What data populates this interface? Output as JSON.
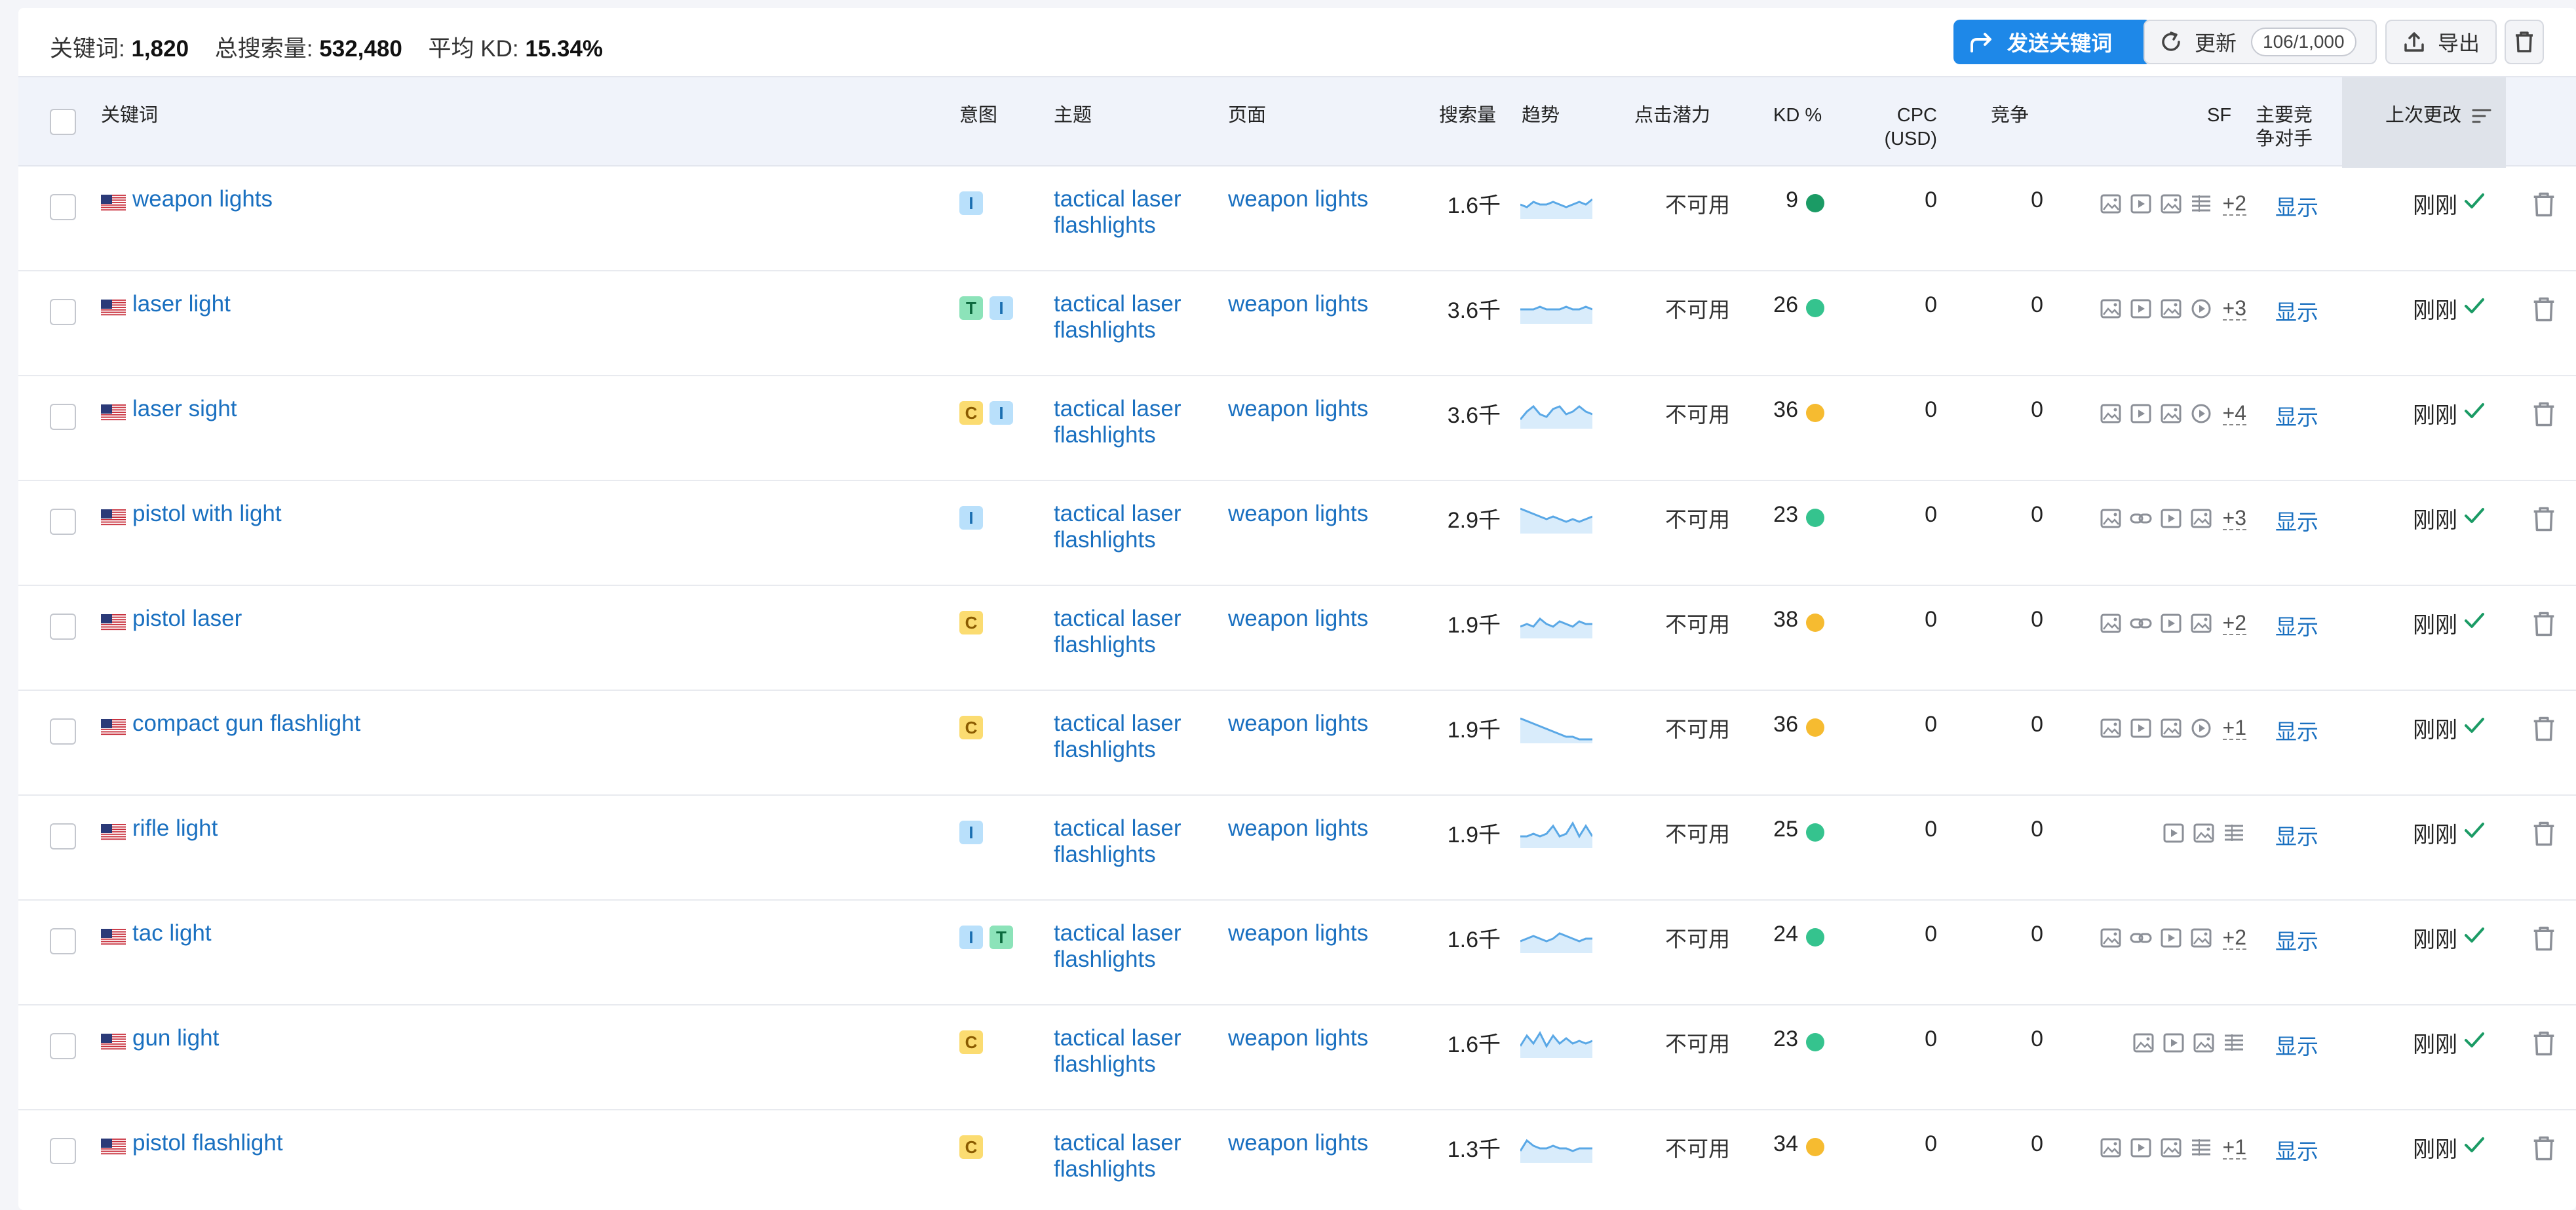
{
  "summary": {
    "keywords_label": "关键词:",
    "keywords_value": "1,820",
    "volume_label": "总搜索量:",
    "volume_value": "532,480",
    "kd_label": "平均 KD:",
    "kd_value": "15.34%"
  },
  "toolbar": {
    "send_label": "发送关键词",
    "update_label": "更新",
    "update_counter": "106/1,000",
    "export_label": "导出"
  },
  "columns": {
    "keyword": "关键词",
    "intent": "意图",
    "topic": "主题",
    "page": "页面",
    "volume": "搜索量",
    "trend": "趋势",
    "potential": "点击潜力",
    "kd": "KD %",
    "cpc_line1": "CPC",
    "cpc_line2": "(USD)",
    "competition": "竞争",
    "sf": "SF",
    "competitor_line1": "主要竞",
    "competitor_line2": "争对手",
    "last_changed": "上次更改"
  },
  "colors": {
    "kd_green": "#35c38e",
    "kd_yellow": "#f6bb30",
    "kd_dark_green": "#1b9b65",
    "link": "#1a70c0",
    "primary": "#1e88e8"
  },
  "rows": [
    {
      "keyword": "weapon lights",
      "intents": [
        "I"
      ],
      "topic": "tactical laser flashlights",
      "page": "weapon lights",
      "volume": "1.6千",
      "trend": [
        5,
        4,
        6,
        5,
        5,
        6,
        5,
        4,
        5,
        6,
        5,
        7
      ],
      "potential": "不可用",
      "kd": "9",
      "kd_color": "#1b9b65",
      "cpc": "0",
      "competition": "0",
      "sf_icons": [
        "image-icon",
        "video-icon",
        "image-icon",
        "list-icon"
      ],
      "sf_more": "+2",
      "competitor": "显示",
      "changed": "刚刚"
    },
    {
      "keyword": "laser light",
      "intents": [
        "T",
        "I"
      ],
      "topic": "tactical laser flashlights",
      "page": "weapon lights",
      "volume": "3.6千",
      "trend": [
        5,
        5,
        5,
        6,
        5,
        5,
        5,
        6,
        5,
        5,
        6,
        5
      ],
      "potential": "不可用",
      "kd": "26",
      "kd_color": "#35c38e",
      "cpc": "0",
      "competition": "0",
      "sf_icons": [
        "image-icon",
        "video-icon",
        "image-icon",
        "play-circle-icon"
      ],
      "sf_more": "+3",
      "competitor": "显示",
      "changed": "刚刚"
    },
    {
      "keyword": "laser sight",
      "intents": [
        "C",
        "I"
      ],
      "topic": "tactical laser flashlights",
      "page": "weapon lights",
      "volume": "3.6千",
      "trend": [
        3,
        6,
        8,
        5,
        4,
        7,
        8,
        5,
        6,
        8,
        6,
        5
      ],
      "potential": "不可用",
      "kd": "36",
      "kd_color": "#f6bb30",
      "cpc": "0",
      "competition": "0",
      "sf_icons": [
        "image-icon",
        "video-icon",
        "image-icon",
        "play-circle-icon"
      ],
      "sf_more": "+4",
      "competitor": "显示",
      "changed": "刚刚"
    },
    {
      "keyword": "pistol with light",
      "intents": [
        "I"
      ],
      "topic": "tactical laser flashlights",
      "page": "weapon lights",
      "volume": "2.9千",
      "trend": [
        9,
        8,
        7,
        6,
        5,
        6,
        5,
        4,
        5,
        4,
        5,
        6
      ],
      "potential": "不可用",
      "kd": "23",
      "kd_color": "#35c38e",
      "cpc": "0",
      "competition": "0",
      "sf_icons": [
        "image-icon",
        "link-icon",
        "video-icon",
        "image-icon"
      ],
      "sf_more": "+3",
      "competitor": "显示",
      "changed": "刚刚"
    },
    {
      "keyword": "pistol laser",
      "intents": [
        "C"
      ],
      "topic": "tactical laser flashlights",
      "page": "weapon lights",
      "volume": "1.9千",
      "trend": [
        4,
        5,
        4,
        7,
        5,
        4,
        6,
        5,
        4,
        6,
        5,
        5
      ],
      "potential": "不可用",
      "kd": "38",
      "kd_color": "#f6bb30",
      "cpc": "0",
      "competition": "0",
      "sf_icons": [
        "image-icon",
        "link-icon",
        "video-icon",
        "image-icon"
      ],
      "sf_more": "+2",
      "competitor": "显示",
      "changed": "刚刚"
    },
    {
      "keyword": "compact gun flashlight",
      "intents": [
        "C"
      ],
      "topic": "tactical laser flashlights",
      "page": "weapon lights",
      "volume": "1.9千",
      "trend": [
        9,
        8,
        7,
        6,
        5,
        4,
        3,
        2,
        2,
        1,
        1,
        1
      ],
      "potential": "不可用",
      "kd": "36",
      "kd_color": "#f6bb30",
      "cpc": "0",
      "competition": "0",
      "sf_icons": [
        "image-icon",
        "video-icon",
        "image-icon",
        "play-circle-icon"
      ],
      "sf_more": "+1",
      "competitor": "显示",
      "changed": "刚刚"
    },
    {
      "keyword": "rifle light",
      "intents": [
        "I"
      ],
      "topic": "tactical laser flashlights",
      "page": "weapon lights",
      "volume": "1.9千",
      "trend": [
        4,
        4,
        5,
        4,
        5,
        8,
        4,
        5,
        9,
        4,
        8,
        4
      ],
      "potential": "不可用",
      "kd": "25",
      "kd_color": "#35c38e",
      "cpc": "0",
      "competition": "0",
      "sf_icons": [
        "video-icon",
        "image-icon",
        "list-icon"
      ],
      "sf_more": "",
      "competitor": "显示",
      "changed": "刚刚"
    },
    {
      "keyword": "tac light",
      "intents": [
        "I",
        "T"
      ],
      "topic": "tactical laser flashlights",
      "page": "weapon lights",
      "volume": "1.6千",
      "trend": [
        4,
        5,
        6,
        5,
        4,
        5,
        7,
        6,
        5,
        4,
        5,
        5
      ],
      "potential": "不可用",
      "kd": "24",
      "kd_color": "#35c38e",
      "cpc": "0",
      "competition": "0",
      "sf_icons": [
        "image-icon",
        "link-icon",
        "video-icon",
        "image-icon"
      ],
      "sf_more": "+2",
      "competitor": "显示",
      "changed": "刚刚"
    },
    {
      "keyword": "gun light",
      "intents": [
        "C"
      ],
      "topic": "tactical laser flashlights",
      "page": "weapon lights",
      "volume": "1.6千",
      "trend": [
        4,
        8,
        5,
        9,
        4,
        8,
        5,
        7,
        5,
        6,
        5,
        6
      ],
      "potential": "不可用",
      "kd": "23",
      "kd_color": "#35c38e",
      "cpc": "0",
      "competition": "0",
      "sf_icons": [
        "image-icon",
        "video-icon",
        "image-icon",
        "list-icon"
      ],
      "sf_more": "",
      "competitor": "显示",
      "changed": "刚刚"
    },
    {
      "keyword": "pistol flashlight",
      "intents": [
        "C"
      ],
      "topic": "tactical laser flashlights",
      "page": "weapon lights",
      "volume": "1.3千",
      "trend": [
        4,
        8,
        6,
        5,
        5,
        6,
        5,
        5,
        4,
        5,
        5,
        5
      ],
      "potential": "不可用",
      "kd": "34",
      "kd_color": "#f6bb30",
      "cpc": "0",
      "competition": "0",
      "sf_icons": [
        "image-icon",
        "video-icon",
        "image-icon",
        "list-icon"
      ],
      "sf_more": "+1",
      "competitor": "显示",
      "changed": "刚刚"
    }
  ]
}
